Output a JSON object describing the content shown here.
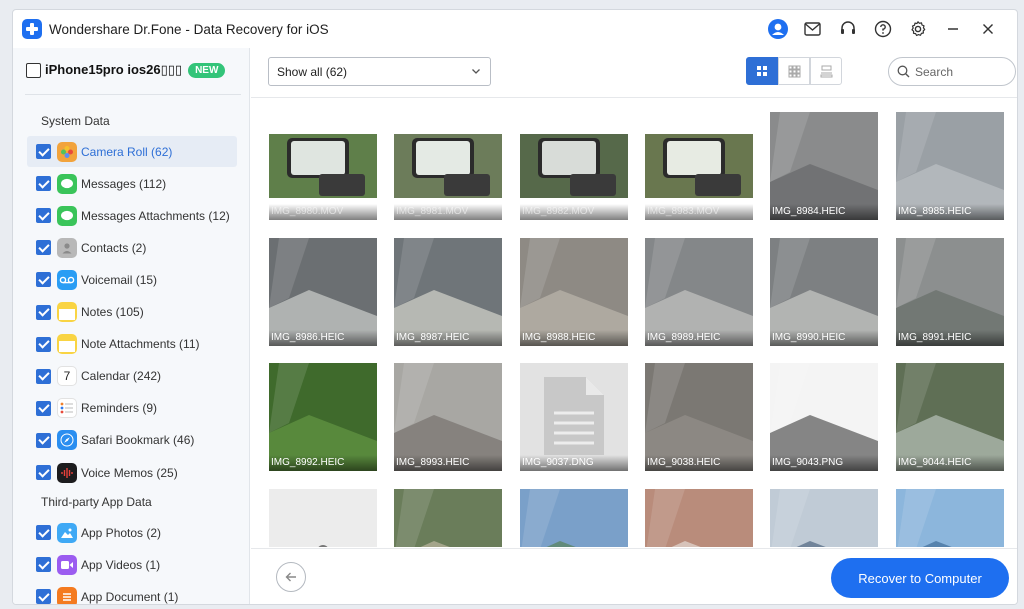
{
  "window": {
    "title": "Wondershare Dr.Fone - Data Recovery for iOS",
    "icons": [
      "account-icon",
      "mail-icon",
      "support-icon",
      "help-icon",
      "settings-icon",
      "minimize-icon",
      "close-icon"
    ]
  },
  "sidebar": {
    "device_name": "iPhone15pro ios26▯▯▯",
    "new_badge": "NEW",
    "system_title": "System Data",
    "third_party_title": "Third-party App Data",
    "system_items": [
      {
        "label": "Camera Roll (62)",
        "icon": "camera-roll-icon",
        "color": "#f2a33c"
      },
      {
        "label": "Messages (112)",
        "icon": "messages-icon",
        "color": "#3ac45a"
      },
      {
        "label": "Messages Attachments (12)",
        "icon": "messages-attachments-icon",
        "color": "#3ac45a"
      },
      {
        "label": "Contacts (2)",
        "icon": "contacts-icon",
        "color": "#b8b8b8"
      },
      {
        "label": "Voicemail (15)",
        "icon": "voicemail-icon",
        "color": "#2a9df4"
      },
      {
        "label": "Notes (105)",
        "icon": "notes-icon",
        "color": "#f9d443"
      },
      {
        "label": "Note Attachments (11)",
        "icon": "note-attachments-icon",
        "color": "#f9d443"
      },
      {
        "label": "Calendar (242)",
        "icon": "calendar-icon",
        "color": "#ffffff"
      },
      {
        "label": "Reminders (9)",
        "icon": "reminders-icon",
        "color": "#ffffff"
      },
      {
        "label": "Safari Bookmark (46)",
        "icon": "safari-icon",
        "color": "#2a8ef0"
      },
      {
        "label": "Voice Memos (25)",
        "icon": "voice-memos-icon",
        "color": "#1c1c1e"
      }
    ],
    "third_party_items": [
      {
        "label": "App Photos (2)",
        "icon": "app-photos-icon",
        "color": "#3fa9f5"
      },
      {
        "label": "App Videos (1)",
        "icon": "app-videos-icon",
        "color": "#9b5cf0"
      },
      {
        "label": "App Document (1)",
        "icon": "app-document-icon",
        "color": "#f47a1f"
      }
    ],
    "calendar_day": "7"
  },
  "toolbar": {
    "filter_value": "Show all (62)",
    "search_placeholder": "Search",
    "views": [
      "grid-view-icon",
      "thumbnail-view-icon",
      "list-view-icon"
    ]
  },
  "grid": {
    "files": [
      {
        "name": "IMG_8980.MOV",
        "kind": "video",
        "bg": "#5f7f4a",
        "accent": "#dfe5e0"
      },
      {
        "name": "IMG_8981.MOV",
        "kind": "video",
        "bg": "#6c7c5a",
        "accent": "#e4eae4"
      },
      {
        "name": "IMG_8982.MOV",
        "kind": "video",
        "bg": "#56694a",
        "accent": "#d8dcd8"
      },
      {
        "name": "IMG_8983.MOV",
        "kind": "video",
        "bg": "#69774f",
        "accent": "#e7ebe3"
      },
      {
        "name": "IMG_8984.HEIC",
        "kind": "photo",
        "bg": "#8a8b8c",
        "accent": "#5d5f61"
      },
      {
        "name": "IMG_8985.HEIC",
        "kind": "photo",
        "bg": "#9aa0a5",
        "accent": "#c6cacd"
      },
      {
        "name": "IMG_8986.HEIC",
        "kind": "photo",
        "bg": "#6b6f72",
        "accent": "#e8e9e5"
      },
      {
        "name": "IMG_8987.HEIC",
        "kind": "photo",
        "bg": "#6f7579",
        "accent": "#f1efe4"
      },
      {
        "name": "IMG_8988.HEIC",
        "kind": "photo",
        "bg": "#8e8a84",
        "accent": "#c9c3b8"
      },
      {
        "name": "IMG_8989.HEIC",
        "kind": "photo",
        "bg": "#848789",
        "accent": "#d7d6d2"
      },
      {
        "name": "IMG_8990.HEIC",
        "kind": "photo",
        "bg": "#7d8082",
        "accent": "#dedfdb"
      },
      {
        "name": "IMG_8991.HEIC",
        "kind": "photo",
        "bg": "#8c8f8f",
        "accent": "#5c665e"
      },
      {
        "name": "IMG_8992.HEIC",
        "kind": "photo",
        "bg": "#3f6a2c",
        "accent": "#6ea34a"
      },
      {
        "name": "IMG_8993.HEIC",
        "kind": "photo",
        "bg": "#a8a7a3",
        "accent": "#6a6560"
      },
      {
        "name": "IMG_9037.DNG",
        "kind": "doc",
        "bg": "#e2e2e2",
        "accent": "#c8c8c8"
      },
      {
        "name": "IMG_9038.HEIC",
        "kind": "photo",
        "bg": "#7b7873",
        "accent": "#9a968f"
      },
      {
        "name": "IMG_9043.PNG",
        "kind": "photo",
        "bg": "#f4f4f4",
        "accent": "#2a2a2a"
      },
      {
        "name": "IMG_9044.HEIC",
        "kind": "photo",
        "bg": "#5f6f55",
        "accent": "#cfd8d6"
      },
      {
        "name": "",
        "kind": "blank",
        "bg": "#ececec",
        "accent": "#777777"
      },
      {
        "name": "",
        "kind": "photo",
        "bg": "#6a7d5a",
        "accent": "#d3c7b5"
      },
      {
        "name": "",
        "kind": "photo",
        "bg": "#7aa0c9",
        "accent": "#4f7a3a"
      },
      {
        "name": "",
        "kind": "photo",
        "bg": "#b98c7b",
        "accent": "#f1f1ef"
      },
      {
        "name": "",
        "kind": "photo",
        "bg": "#c0cbd6",
        "accent": "#2f4a6a"
      },
      {
        "name": "",
        "kind": "photo",
        "bg": "#8cb6dc",
        "accent": "#2b5a87"
      }
    ]
  },
  "bottom": {
    "recover_label": "Recover to Computer"
  },
  "colors": {
    "accent": "#1e6ff0",
    "checkbox": "#2e6fd6",
    "badge": "#33c479"
  }
}
